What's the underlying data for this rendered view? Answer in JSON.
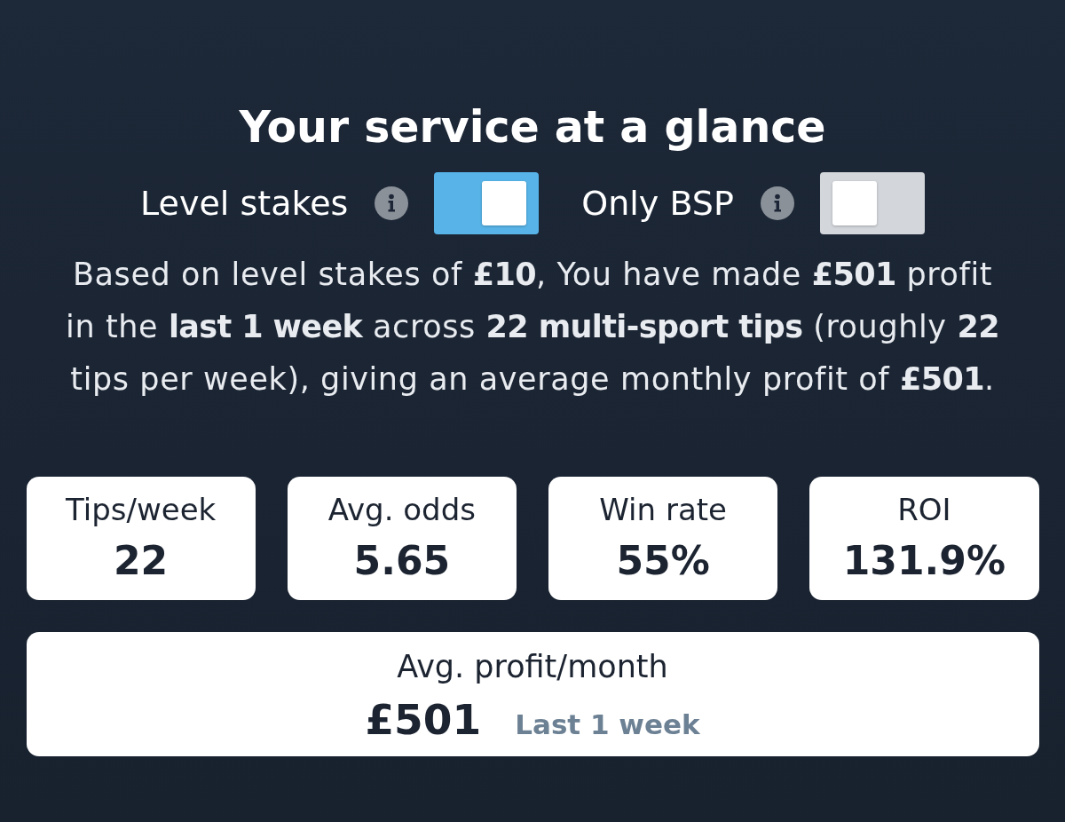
{
  "title": "Your service at a glance",
  "toggles": [
    {
      "label": "Level stakes",
      "on": true
    },
    {
      "label": "Only BSP",
      "on": false
    }
  ],
  "summary": "Based on level stakes of **£10**, You have made **£501** profit in the **last 1 week** across **22 multi-sport tips** (roughly **22** tips per week), giving an average monthly profit of **£501**.",
  "stats": [
    {
      "label": "Tips/week",
      "value": "22"
    },
    {
      "label": "Avg. odds",
      "value": "5.65"
    },
    {
      "label": "Win rate",
      "value": "55%"
    },
    {
      "label": "ROI",
      "value": "131.9%"
    }
  ],
  "profit": {
    "label": "Avg. profit/month",
    "value": "£501",
    "period": "Last 1 week"
  }
}
